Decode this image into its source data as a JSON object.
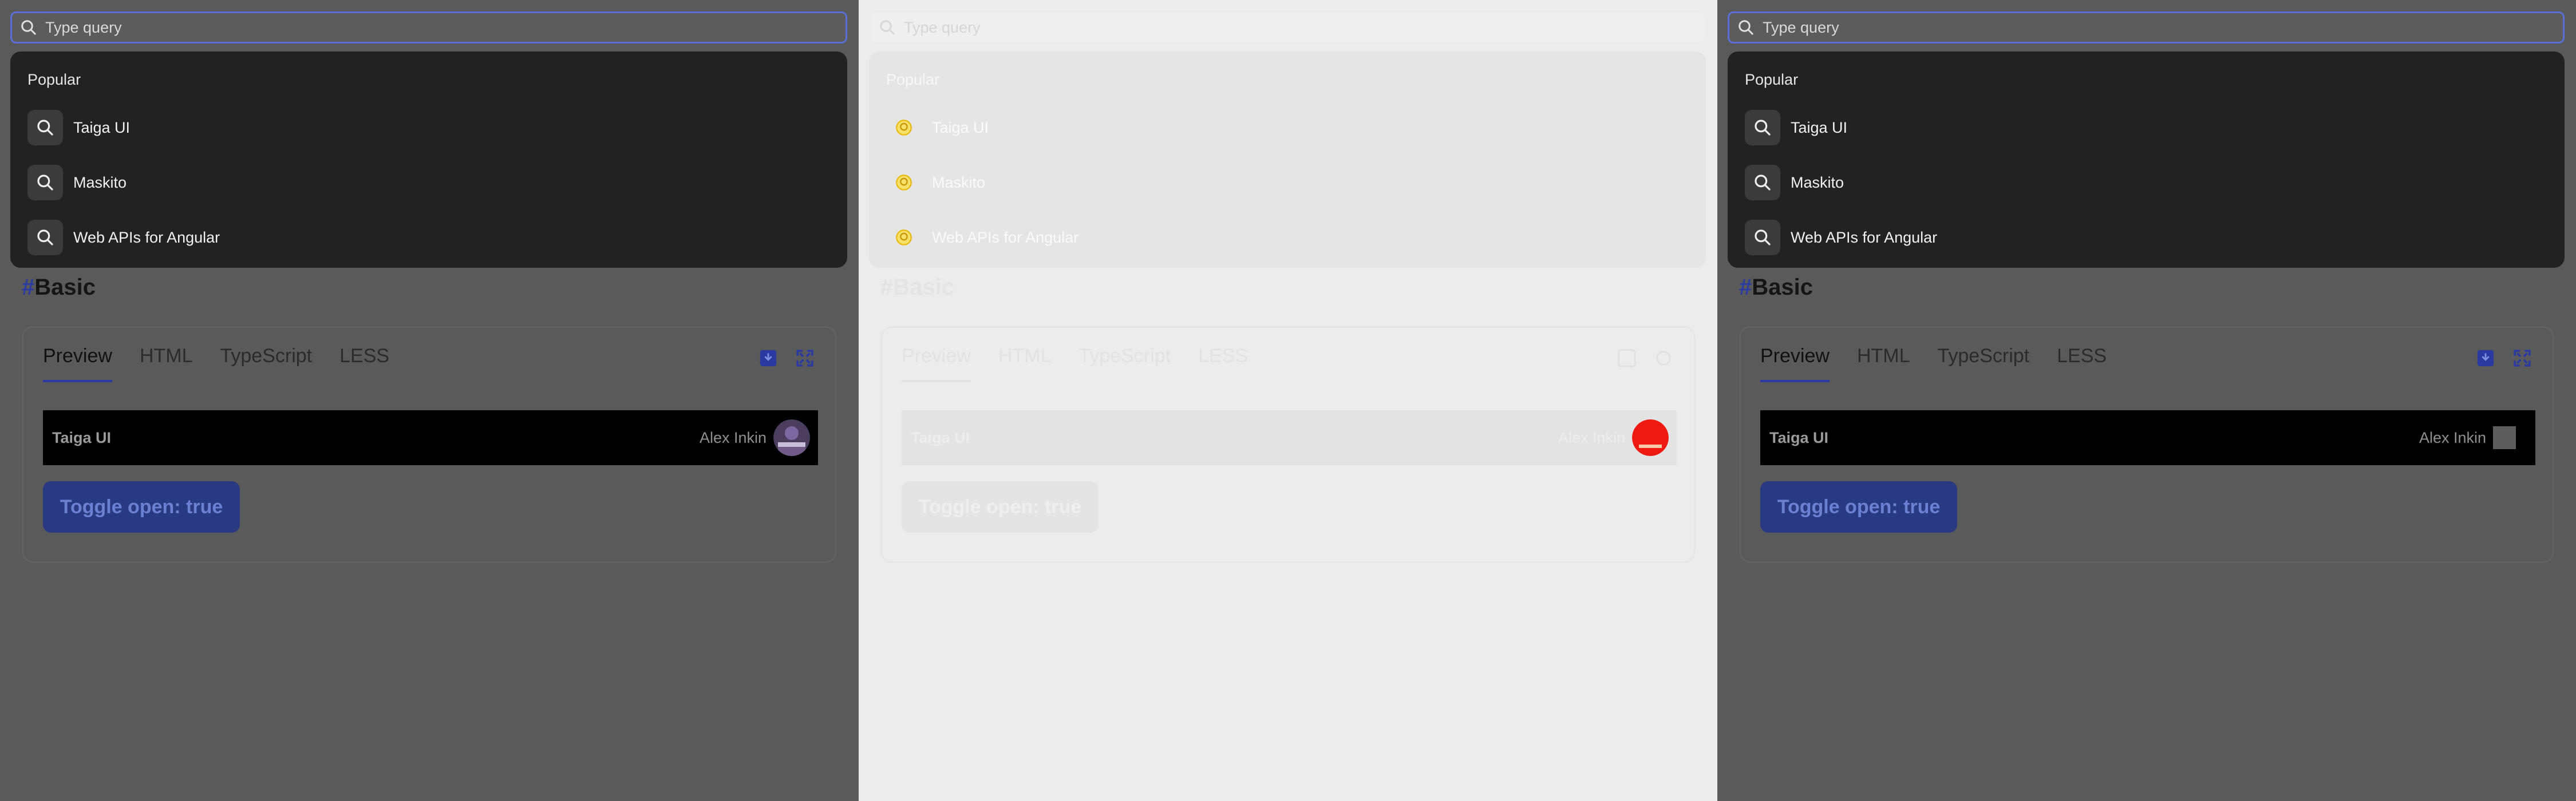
{
  "search": {
    "placeholder": "Type query"
  },
  "dropdown": {
    "section_label": "Popular",
    "items": [
      {
        "label": "Taiga UI"
      },
      {
        "label": "Maskito"
      },
      {
        "label": "Web APIs for Angular"
      }
    ]
  },
  "doc": {
    "hash": "#",
    "heading": "Basic",
    "tabs": [
      "Preview",
      "HTML",
      "TypeScript",
      "LESS"
    ],
    "active_tab": "Preview"
  },
  "demo": {
    "brand": "Taiga UI",
    "user_name": "Alex Inkin",
    "toggle_label": "Toggle open: true"
  },
  "icons": {
    "search": "search-icon",
    "import": "import-icon",
    "fullscreen": "fullscreen-icon",
    "avatar": "avatar-image",
    "emoji": "lightbulb-icon"
  },
  "colors": {
    "accent": "#5b6ed8",
    "brand_dark": "#2b3aa0",
    "dropdown_bg": "#222222",
    "overlay": "#5a5a5a"
  }
}
